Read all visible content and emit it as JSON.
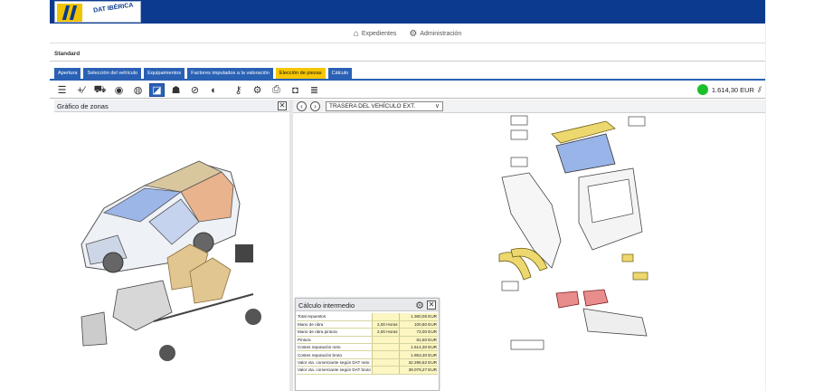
{
  "brand": {
    "logo_text": "DAT IBÉRICA"
  },
  "nav": {
    "items": [
      {
        "icon": "home-icon",
        "label": "Expedientes"
      },
      {
        "icon": "gear-icon",
        "label": "Administración"
      }
    ]
  },
  "context": {
    "label": "Standard"
  },
  "tabs": [
    {
      "label": "Apertura",
      "active": false
    },
    {
      "label": "Selección del vehículo",
      "active": false
    },
    {
      "label": "Equipamientos",
      "active": false
    },
    {
      "label": "Factores imputados a la valoración",
      "active": false
    },
    {
      "label": "Elección de piezas",
      "active": true
    },
    {
      "label": "Cálculo",
      "active": false
    }
  ],
  "toolbar": {
    "total": "1.614,30 EUR",
    "total_status_color": "#1bbf2a"
  },
  "left_panel": {
    "title": "Gráfico de zonas",
    "close": "✕"
  },
  "right_panel": {
    "zone": "TRASERA DEL VEHÍCULO EXT."
  },
  "calc": {
    "title": "Cálculo intermedio",
    "close": "✕",
    "rows": [
      {
        "label": "Total repuestos",
        "hours": "",
        "value": "1.360,06 EUR"
      },
      {
        "label": "Mano de obra",
        "hours": "2,00 Horas",
        "value": "100,80 EUR"
      },
      {
        "label": "Mano de obra pintura",
        "hours": "2,00 Horas",
        "value": "72,00 EUR"
      },
      {
        "label": "Pintura",
        "hours": "",
        "value": "81,50 EUR"
      },
      {
        "label": "Costes reparación neto",
        "hours": "",
        "value": "1.614,30 EUR"
      },
      {
        "label": "Costes reparación bruto",
        "hours": "",
        "value": "1.953,30 EUR"
      },
      {
        "label": "Valor vta. comerciante según DAT neto",
        "hours": "",
        "value": "32.296,62 EUR"
      },
      {
        "label": "Valor vta. comerciante según DAT bruto",
        "hours": "",
        "value": "39.079,27 EUR"
      }
    ]
  },
  "colors": {
    "header_blue": "#0b3a8f",
    "tab_blue": "#2a61b5",
    "tab_active": "#f7c600",
    "part_yellow": "#ecd86e",
    "part_blue": "#98b4e8",
    "seat_beige": "#e2c690"
  }
}
